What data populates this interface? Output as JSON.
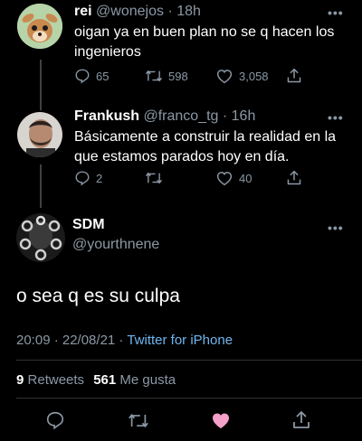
{
  "tweets": [
    {
      "name": "rei",
      "handle": "@wonejos",
      "time": "18h",
      "text_line1": "oigan ya en buen plan no se q hacen los",
      "text_line2": "ingenieros",
      "replies": "65",
      "retweets": "598",
      "likes": "3,058",
      "avatar_icon": "cartoon-deer-avatar"
    },
    {
      "name": "Frankush",
      "handle": "@franco_tg",
      "time": "16h",
      "text_line1": "Básicamente a construir la realidad en la",
      "text_line2": "que estamos parados hoy en día.",
      "replies": "2",
      "retweets": "",
      "likes": "40",
      "avatar_icon": "person-photo-avatar"
    }
  ],
  "main": {
    "name": "SDM",
    "handle": "@yourthnene",
    "text": "o sea q es su culpa",
    "timestamp": "20:09 · 22/08/21 ·",
    "source": "Twitter for iPhone",
    "retweet_count": "9",
    "retweet_label": "Retweets",
    "like_count": "561",
    "like_label": "Me gusta",
    "avatar_icon": "chain-photo-avatar"
  },
  "separator": "·",
  "more_glyph": "•••",
  "colors": {
    "background": "#000000",
    "text": "#ffffff",
    "muted": "#8b98a5",
    "link": "#6fb6f0",
    "liked": "#f4a0c8",
    "thread_line": "#3e4144"
  }
}
